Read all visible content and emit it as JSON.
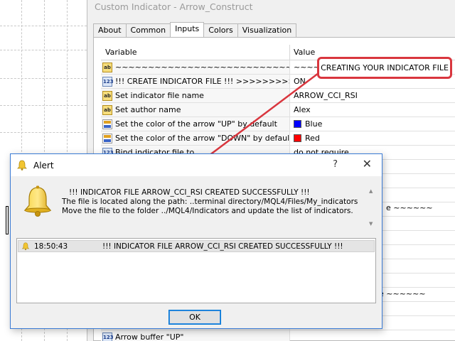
{
  "window": {
    "title": "Custom Indicator - Arrow_Construct"
  },
  "tabs": [
    {
      "label": "About",
      "active": false
    },
    {
      "label": "Common",
      "active": false
    },
    {
      "label": "Inputs",
      "active": true
    },
    {
      "label": "Colors",
      "active": false
    },
    {
      "label": "Visualization",
      "active": false
    }
  ],
  "grid": {
    "col_variable": "Variable",
    "col_value": "Value",
    "rows": [
      {
        "icon": "ab",
        "variable": "~~~~~~~~~~~~~~~~~~~~~~~~~~~~~~~~~~~~~~~~~~~",
        "value": "~~~~~~"
      },
      {
        "icon": "123",
        "variable": "!!! CREATE INDICATOR FILE !!! >>>>>>>>>>>>>>>>>>>>>>>>",
        "value": "ON"
      },
      {
        "icon": "ab",
        "variable": "Set indicator file name",
        "value": "ARROW_CCI_RSI"
      },
      {
        "icon": "ab",
        "variable": "Set author name",
        "value": "Alex"
      },
      {
        "icon": "color",
        "variable": "Set the color of the arrow \"UP\" by default",
        "value": "Blue",
        "swatch": "#0000ff"
      },
      {
        "icon": "color",
        "variable": "Set the color of the arrow \"DOWN\" by default",
        "value": "Red",
        "swatch": "#ff0000"
      },
      {
        "icon": "123",
        "variable": "Bind indicator file to",
        "value": "do not require"
      }
    ],
    "bottom_row": {
      "icon": "123",
      "variable": "Arrow buffer \"UP\""
    }
  },
  "callout": {
    "text": "CREATING YOUR INDICATOR FILE",
    "color": "#d9363e"
  },
  "fragments": {
    "f1": "e ~~~~~~",
    "f2": "e ~~~~~~"
  },
  "alert": {
    "title": "Alert",
    "help_glyph": "?",
    "close_glyph": "✕",
    "message": [
      "!!! INDICATOR FILE ARROW_CCI_RSI CREATED SUCCESSFULLY !!!",
      "The file is located along the path: ..terminal directory/MQL4/Files/My_indicators",
      "Move the file to the folder ../MQL4/Indicators and update the list of indicators."
    ],
    "log": [
      {
        "time": "18:50:43",
        "text": "!!! INDICATOR FILE ARROW_CCI_RSI CREATED SUCCESSFULLY !!!"
      }
    ],
    "ok_label": "OK"
  },
  "icons": {
    "bell": "bell-icon",
    "string_param": "ab-icon",
    "numeric_param": "123-icon",
    "color_param": "color-icon"
  },
  "colors": {
    "accent": "#0078d7",
    "highlight": "#d9363e"
  }
}
